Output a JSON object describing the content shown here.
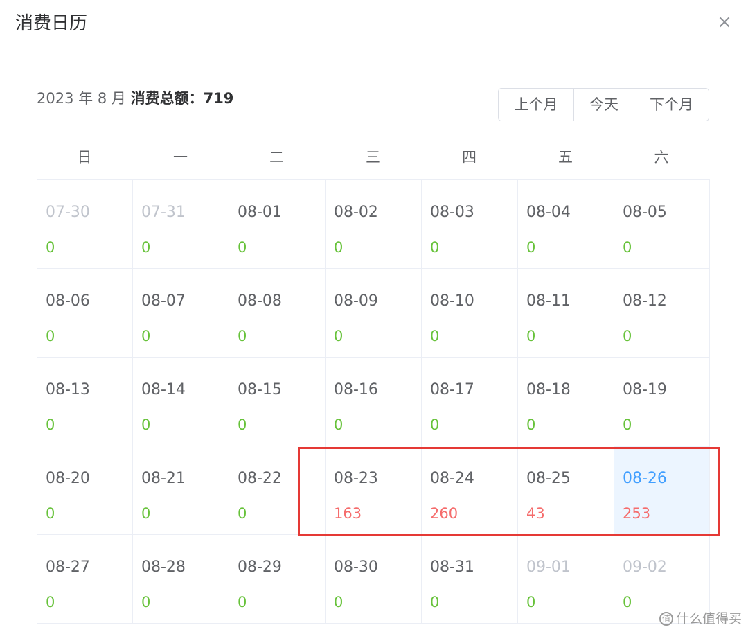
{
  "dialog": {
    "title": "消费日历",
    "close_glyph": "×"
  },
  "summary": {
    "year": "2023",
    "year_unit": "年",
    "month": "8",
    "month_unit": "月",
    "total_label": "消费总额：",
    "total_value": "719"
  },
  "nav": {
    "prev_label": "上个月",
    "today_label": "今天",
    "next_label": "下个月"
  },
  "weekdays": [
    "日",
    "一",
    "二",
    "三",
    "四",
    "五",
    "六"
  ],
  "days": [
    {
      "date": "07-30",
      "amount": "0",
      "other_month": true
    },
    {
      "date": "07-31",
      "amount": "0",
      "other_month": true
    },
    {
      "date": "08-01",
      "amount": "0"
    },
    {
      "date": "08-02",
      "amount": "0"
    },
    {
      "date": "08-03",
      "amount": "0"
    },
    {
      "date": "08-04",
      "amount": "0"
    },
    {
      "date": "08-05",
      "amount": "0"
    },
    {
      "date": "08-06",
      "amount": "0"
    },
    {
      "date": "08-07",
      "amount": "0"
    },
    {
      "date": "08-08",
      "amount": "0"
    },
    {
      "date": "08-09",
      "amount": "0"
    },
    {
      "date": "08-10",
      "amount": "0"
    },
    {
      "date": "08-11",
      "amount": "0"
    },
    {
      "date": "08-12",
      "amount": "0"
    },
    {
      "date": "08-13",
      "amount": "0"
    },
    {
      "date": "08-14",
      "amount": "0"
    },
    {
      "date": "08-15",
      "amount": "0"
    },
    {
      "date": "08-16",
      "amount": "0"
    },
    {
      "date": "08-17",
      "amount": "0"
    },
    {
      "date": "08-18",
      "amount": "0"
    },
    {
      "date": "08-19",
      "amount": "0"
    },
    {
      "date": "08-20",
      "amount": "0"
    },
    {
      "date": "08-21",
      "amount": "0"
    },
    {
      "date": "08-22",
      "amount": "0"
    },
    {
      "date": "08-23",
      "amount": "163",
      "has_spend": true
    },
    {
      "date": "08-24",
      "amount": "260",
      "has_spend": true
    },
    {
      "date": "08-25",
      "amount": "43",
      "has_spend": true
    },
    {
      "date": "08-26",
      "amount": "253",
      "has_spend": true,
      "selected": true
    },
    {
      "date": "08-27",
      "amount": "0"
    },
    {
      "date": "08-28",
      "amount": "0"
    },
    {
      "date": "08-29",
      "amount": "0"
    },
    {
      "date": "08-30",
      "amount": "0"
    },
    {
      "date": "08-31",
      "amount": "0"
    },
    {
      "date": "09-01",
      "amount": "0",
      "other_month": true
    },
    {
      "date": "09-02",
      "amount": "0",
      "other_month": true
    }
  ],
  "watermark": {
    "logo_glyph": "值",
    "text": "什么值得买"
  },
  "colors": {
    "zero_amount": "#67c23a",
    "spend_amount": "#f56c6c",
    "selected_bg": "#ecf5ff",
    "selected_date": "#409eff",
    "highlight_border": "#e53935"
  }
}
